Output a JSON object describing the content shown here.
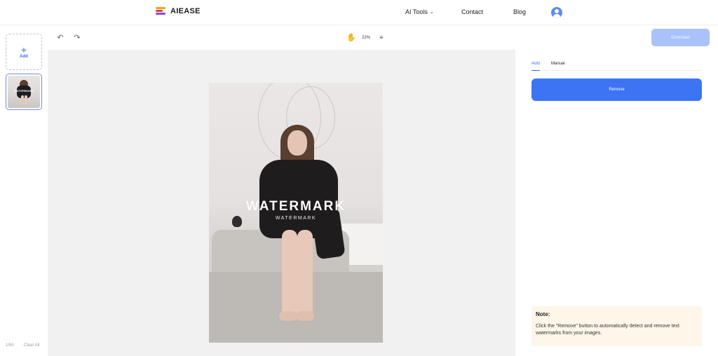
{
  "nav": {
    "logo_text": "AIEASE",
    "ai_tools": "AI Tools",
    "contact": "Contact",
    "blog": "Blog"
  },
  "sidebar": {
    "add_label": "Add",
    "thumb_watermark": "WATERMARK",
    "count": "1/50",
    "clear_all": "Clear All"
  },
  "toolbar": {
    "zoom": "22%",
    "download": "Download"
  },
  "canvas": {
    "watermark_big": "WATERMARK",
    "watermark_small": "WATERMARK"
  },
  "panel": {
    "tabs": [
      "Auto",
      "Manual"
    ],
    "active_tab": "Auto",
    "remove_label": "Remove",
    "note_title": "Note:",
    "note_text": "Click the \"Remove\" button to automatically detect and remove text watermarks from your images."
  },
  "colors": {
    "accent": "#3d74f4",
    "download_disabled": "#a9c2fb",
    "note_bg": "#fdf6e9"
  }
}
